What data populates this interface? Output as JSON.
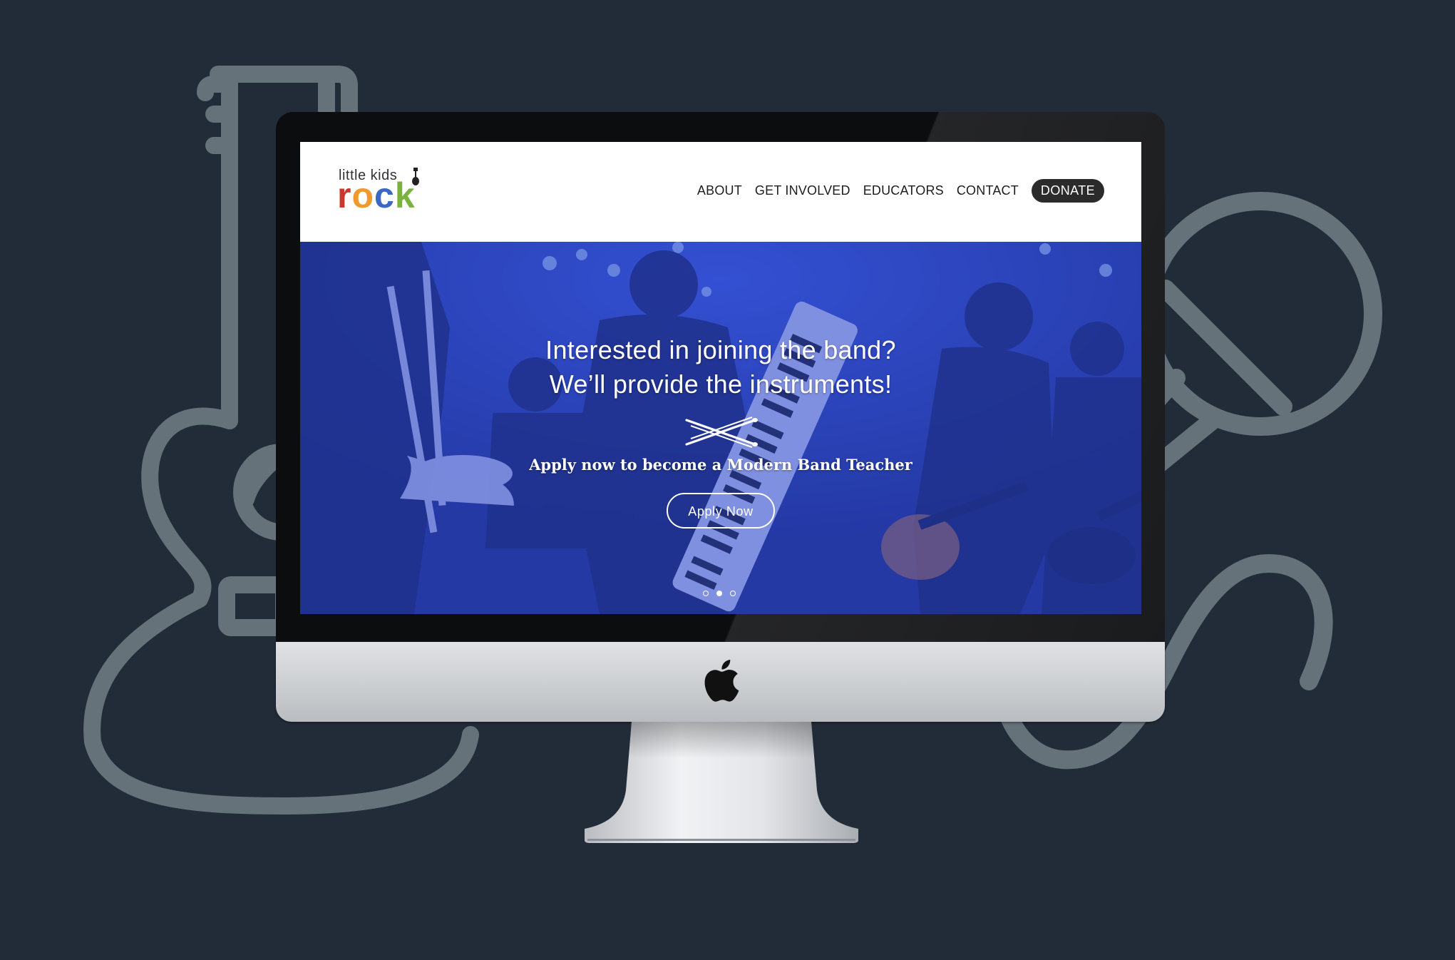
{
  "site": {
    "logo": {
      "small_text": "little kids",
      "big_letters": [
        "r",
        "o",
        "c",
        "k"
      ]
    },
    "nav": {
      "items": [
        "ABOUT",
        "GET INVOLVED",
        "EDUCATORS",
        "CONTACT"
      ],
      "donate_label": "DONATE"
    },
    "hero": {
      "headline_line1": "Interested in joining the band?",
      "headline_line2": "We’ll provide the instruments!",
      "subheading": "Apply now to become a Modern Band Teacher",
      "cta_label": "Apply  Now",
      "slides_total": 3,
      "active_slide": 2
    }
  },
  "colors": {
    "page_background": "#222c38",
    "background_icon_stroke": "#66727a",
    "logo_r": "#c8392b",
    "logo_o": "#ef9a2a",
    "logo_c": "#3a68c4",
    "logo_k": "#7ab23e",
    "donate_background": "#2b2b2b",
    "hero_tint": "#2c46c8"
  },
  "icons": {
    "background_left": "acoustic-guitar-outline-icon",
    "background_right": "microphone-outline-icon",
    "hero_divider": "drumsticks-icon",
    "device_logo": "apple-logo-icon"
  }
}
